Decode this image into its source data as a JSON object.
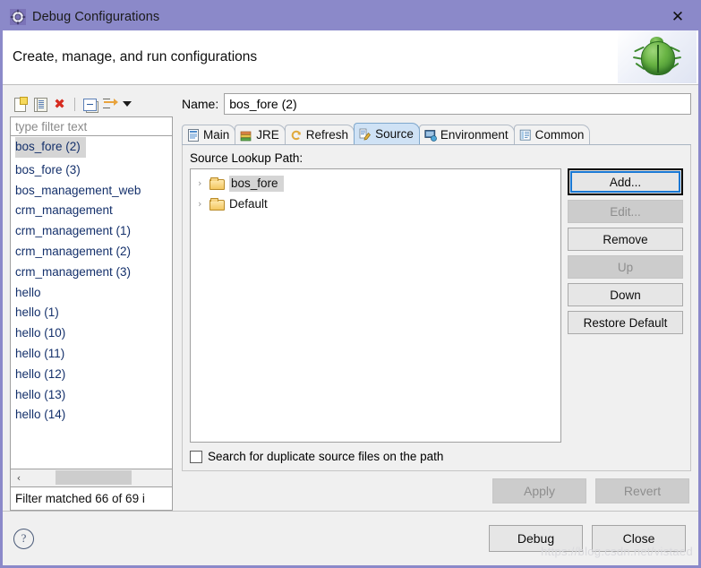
{
  "window": {
    "title": "Debug Configurations",
    "title_icon": "gear-icon",
    "close_icon": "✕",
    "accent_color": "#8b89c9"
  },
  "header": {
    "title": "Create, manage, and run configurations",
    "banner_icon": "bug-icon"
  },
  "left_panel": {
    "toolbar": [
      {
        "name": "new-launch-configuration-icon",
        "label": "New launch configuration"
      },
      {
        "name": "duplicate-icon",
        "label": "Duplicate"
      },
      {
        "name": "delete-icon",
        "label": "Delete"
      },
      {
        "name": "collapse-all-icon",
        "label": "Collapse All"
      },
      {
        "name": "filter-icon",
        "label": "Filter launch configurations"
      },
      {
        "name": "chevron-down-icon",
        "label": "View menu"
      }
    ],
    "filter": {
      "placeholder": "type filter text",
      "value": ""
    },
    "items": [
      {
        "label": "bos_fore (2)",
        "selected": true
      },
      {
        "label": "bos_fore (3)",
        "selected": false
      },
      {
        "label": "bos_management_web",
        "selected": false
      },
      {
        "label": "crm_management",
        "selected": false
      },
      {
        "label": "crm_management (1)",
        "selected": false
      },
      {
        "label": "crm_management (2)",
        "selected": false
      },
      {
        "label": "crm_management (3)",
        "selected": false
      },
      {
        "label": "hello",
        "selected": false
      },
      {
        "label": "hello (1)",
        "selected": false
      },
      {
        "label": "hello (10)",
        "selected": false
      },
      {
        "label": "hello (11)",
        "selected": false
      },
      {
        "label": "hello (12)",
        "selected": false
      },
      {
        "label": "hello (13)",
        "selected": false
      },
      {
        "label": "hello (14)",
        "selected": false
      }
    ],
    "scrollbar": {
      "left_arrow": "‹"
    },
    "status": "Filter matched 66 of 69 i"
  },
  "right_panel": {
    "name_label": "Name:",
    "name_value": "bos_fore (2)",
    "tabs": [
      {
        "label": "Main",
        "icon": "main-tab-icon",
        "active": false
      },
      {
        "label": "JRE",
        "icon": "jre-tab-icon",
        "active": false
      },
      {
        "label": "Refresh",
        "icon": "refresh-tab-icon",
        "active": false
      },
      {
        "label": "Source",
        "icon": "source-tab-icon",
        "active": true
      },
      {
        "label": "Environment",
        "icon": "environment-tab-icon",
        "active": false
      },
      {
        "label": "Common",
        "icon": "common-tab-icon",
        "active": false
      }
    ],
    "source_tab": {
      "lookup_path_label": "Source Lookup Path:",
      "tree": [
        {
          "label": "bos_fore",
          "icon": "folder-icon",
          "expander": "›",
          "selected": true
        },
        {
          "label": "Default",
          "icon": "folder-icon",
          "expander": "›",
          "selected": false
        }
      ],
      "buttons": [
        {
          "label": "Add...",
          "state": "focused"
        },
        {
          "label": "Edit...",
          "state": "disabled"
        },
        {
          "label": "Remove",
          "state": "enabled"
        },
        {
          "label": "Up",
          "state": "disabled"
        },
        {
          "label": "Down",
          "state": "enabled"
        },
        {
          "label": "Restore Default",
          "state": "enabled"
        }
      ],
      "checkbox": {
        "label": "Search for duplicate source files on the path",
        "checked": false
      }
    },
    "apply_label": "Apply",
    "revert_label": "Revert"
  },
  "footer": {
    "help_icon": "?",
    "debug_label": "Debug",
    "close_label": "Close",
    "watermark": "https://blog.csdn.net/vistaed"
  }
}
